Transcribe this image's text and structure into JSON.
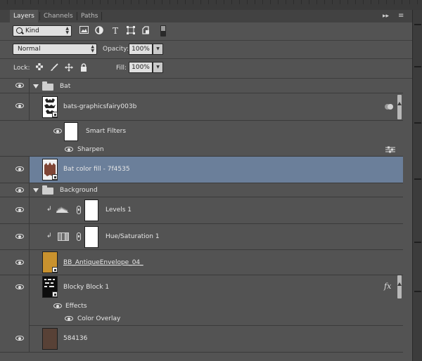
{
  "tabs": [
    {
      "label": "Layers",
      "active": true
    },
    {
      "label": "Channels",
      "active": false
    },
    {
      "label": "Paths",
      "active": false
    }
  ],
  "panel": {
    "collapse_glyph": "▸▸",
    "menu_glyph": "≡"
  },
  "filter": {
    "kind_label": "Kind",
    "icons": [
      "image-filter-icon",
      "adjustment-filter-icon",
      "type-filter-icon",
      "shape-filter-icon",
      "smart-object-filter-icon"
    ]
  },
  "blend": {
    "mode": "Normal",
    "opacity_label": "Opacity:",
    "opacity": "100%",
    "fill_label": "Fill:",
    "fill": "100%"
  },
  "lock": {
    "label": "Lock:",
    "icons": [
      "lock-transparent-icon",
      "lock-image-icon",
      "lock-position-icon",
      "lock-all-icon"
    ]
  },
  "layers": {
    "group_bat": "Bat",
    "bats": "bats-graphicsfairy003b",
    "smart_filters": "Smart Filters",
    "sharpen": "Sharpen",
    "bat_fill": "Bat color fill - 7f4535",
    "group_background": "Background",
    "levels": "Levels 1",
    "hue": "Hue/Saturation 1",
    "envelope": "BB_AntiqueEnvelope_04_",
    "blocky": "Blocky Block 1",
    "effects": "Effects",
    "color_overlay": "Color Overlay",
    "solid": "584136"
  },
  "colors": {
    "panel_bg": "#535353",
    "selected_row": "#6b7f9a",
    "bat_fill": "#7f4535",
    "envelope_thumb": "#c9922e",
    "solid_thumb": "#584136"
  }
}
